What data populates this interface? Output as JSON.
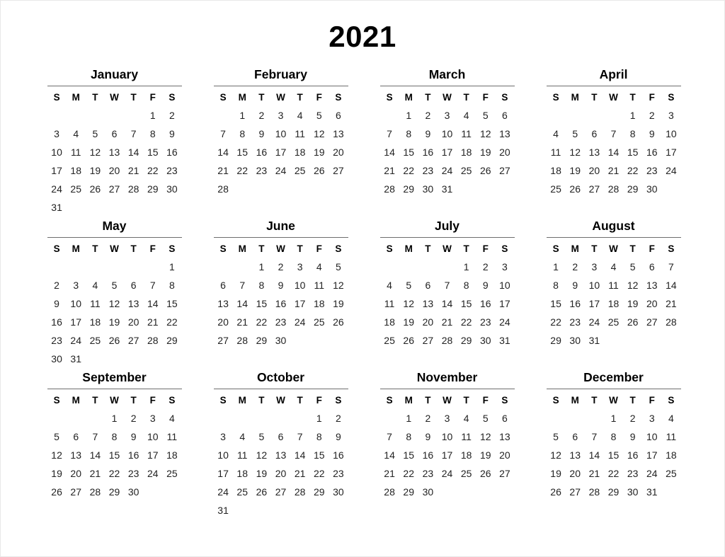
{
  "page": {
    "year_title": "2021",
    "background_color": "#ffffff",
    "text_color": "#1a1a1a",
    "rule_color": "#6e6e6e",
    "border_color": "#e8e8e8"
  },
  "weekday_headers": [
    "S",
    "M",
    "T",
    "W",
    "T",
    "F",
    "S"
  ],
  "chart_data": {
    "type": "table",
    "title": "2021",
    "first_day_of_week": "Sunday",
    "weekday_headers": [
      "S",
      "M",
      "T",
      "W",
      "T",
      "F",
      "S"
    ],
    "months": [
      {
        "name": "January",
        "index": 1,
        "days_in_month": 31,
        "start_weekday_index": 5,
        "weeks": [
          [
            "",
            "",
            "",
            "",
            "",
            "1",
            "2"
          ],
          [
            "3",
            "4",
            "5",
            "6",
            "7",
            "8",
            "9"
          ],
          [
            "10",
            "11",
            "12",
            "13",
            "14",
            "15",
            "16"
          ],
          [
            "17",
            "18",
            "19",
            "20",
            "21",
            "22",
            "23"
          ],
          [
            "24",
            "25",
            "26",
            "27",
            "28",
            "29",
            "30"
          ],
          [
            "31",
            "",
            "",
            "",
            "",
            "",
            ""
          ]
        ]
      },
      {
        "name": "February",
        "index": 2,
        "days_in_month": 28,
        "start_weekday_index": 1,
        "weeks": [
          [
            "",
            "1",
            "2",
            "3",
            "4",
            "5",
            "6"
          ],
          [
            "7",
            "8",
            "9",
            "10",
            "11",
            "12",
            "13"
          ],
          [
            "14",
            "15",
            "16",
            "17",
            "18",
            "19",
            "20"
          ],
          [
            "21",
            "22",
            "23",
            "24",
            "25",
            "26",
            "27"
          ],
          [
            "28",
            "",
            "",
            "",
            "",
            "",
            ""
          ]
        ]
      },
      {
        "name": "March",
        "index": 3,
        "days_in_month": 31,
        "start_weekday_index": 1,
        "weeks": [
          [
            "",
            "1",
            "2",
            "3",
            "4",
            "5",
            "6"
          ],
          [
            "7",
            "8",
            "9",
            "10",
            "11",
            "12",
            "13"
          ],
          [
            "14",
            "15",
            "16",
            "17",
            "18",
            "19",
            "20"
          ],
          [
            "21",
            "22",
            "23",
            "24",
            "25",
            "26",
            "27"
          ],
          [
            "28",
            "29",
            "30",
            "31",
            "",
            "",
            ""
          ]
        ]
      },
      {
        "name": "April",
        "index": 4,
        "days_in_month": 30,
        "start_weekday_index": 4,
        "weeks": [
          [
            "",
            "",
            "",
            "",
            "1",
            "2",
            "3"
          ],
          [
            "4",
            "5",
            "6",
            "7",
            "8",
            "9",
            "10"
          ],
          [
            "11",
            "12",
            "13",
            "14",
            "15",
            "16",
            "17"
          ],
          [
            "18",
            "19",
            "20",
            "21",
            "22",
            "23",
            "24"
          ],
          [
            "25",
            "26",
            "27",
            "28",
            "29",
            "30",
            ""
          ]
        ]
      },
      {
        "name": "May",
        "index": 5,
        "days_in_month": 31,
        "start_weekday_index": 6,
        "weeks": [
          [
            "",
            "",
            "",
            "",
            "",
            "",
            "1"
          ],
          [
            "2",
            "3",
            "4",
            "5",
            "6",
            "7",
            "8"
          ],
          [
            "9",
            "10",
            "11",
            "12",
            "13",
            "14",
            "15"
          ],
          [
            "16",
            "17",
            "18",
            "19",
            "20",
            "21",
            "22"
          ],
          [
            "23",
            "24",
            "25",
            "26",
            "27",
            "28",
            "29"
          ],
          [
            "30",
            "31",
            "",
            "",
            "",
            "",
            ""
          ]
        ]
      },
      {
        "name": "June",
        "index": 6,
        "days_in_month": 30,
        "start_weekday_index": 2,
        "weeks": [
          [
            "",
            "",
            "1",
            "2",
            "3",
            "4",
            "5"
          ],
          [
            "6",
            "7",
            "8",
            "9",
            "10",
            "11",
            "12"
          ],
          [
            "13",
            "14",
            "15",
            "16",
            "17",
            "18",
            "19"
          ],
          [
            "20",
            "21",
            "22",
            "23",
            "24",
            "25",
            "26"
          ],
          [
            "27",
            "28",
            "29",
            "30",
            "",
            "",
            ""
          ]
        ]
      },
      {
        "name": "July",
        "index": 7,
        "days_in_month": 31,
        "start_weekday_index": 4,
        "weeks": [
          [
            "",
            "",
            "",
            "",
            "1",
            "2",
            "3"
          ],
          [
            "4",
            "5",
            "6",
            "7",
            "8",
            "9",
            "10"
          ],
          [
            "11",
            "12",
            "13",
            "14",
            "15",
            "16",
            "17"
          ],
          [
            "18",
            "19",
            "20",
            "21",
            "22",
            "23",
            "24"
          ],
          [
            "25",
            "26",
            "27",
            "28",
            "29",
            "30",
            "31"
          ]
        ]
      },
      {
        "name": "August",
        "index": 8,
        "days_in_month": 31,
        "start_weekday_index": 0,
        "weeks": [
          [
            "1",
            "2",
            "3",
            "4",
            "5",
            "6",
            "7"
          ],
          [
            "8",
            "9",
            "10",
            "11",
            "12",
            "13",
            "14"
          ],
          [
            "15",
            "16",
            "17",
            "18",
            "19",
            "20",
            "21"
          ],
          [
            "22",
            "23",
            "24",
            "25",
            "26",
            "27",
            "28"
          ],
          [
            "29",
            "30",
            "31",
            "",
            "",
            "",
            ""
          ]
        ]
      },
      {
        "name": "September",
        "index": 9,
        "days_in_month": 30,
        "start_weekday_index": 3,
        "weeks": [
          [
            "",
            "",
            "",
            "1",
            "2",
            "3",
            "4"
          ],
          [
            "5",
            "6",
            "7",
            "8",
            "9",
            "10",
            "11"
          ],
          [
            "12",
            "13",
            "14",
            "15",
            "16",
            "17",
            "18"
          ],
          [
            "19",
            "20",
            "21",
            "22",
            "23",
            "24",
            "25"
          ],
          [
            "26",
            "27",
            "28",
            "29",
            "30",
            "",
            ""
          ]
        ]
      },
      {
        "name": "October",
        "index": 10,
        "days_in_month": 31,
        "start_weekday_index": 5,
        "weeks": [
          [
            "",
            "",
            "",
            "",
            "",
            "1",
            "2"
          ],
          [
            "3",
            "4",
            "5",
            "6",
            "7",
            "8",
            "9"
          ],
          [
            "10",
            "11",
            "12",
            "13",
            "14",
            "15",
            "16"
          ],
          [
            "17",
            "18",
            "19",
            "20",
            "21",
            "22",
            "23"
          ],
          [
            "24",
            "25",
            "26",
            "27",
            "28",
            "29",
            "30"
          ],
          [
            "31",
            "",
            "",
            "",
            "",
            "",
            ""
          ]
        ]
      },
      {
        "name": "November",
        "index": 11,
        "days_in_month": 30,
        "start_weekday_index": 1,
        "weeks": [
          [
            "",
            "1",
            "2",
            "3",
            "4",
            "5",
            "6"
          ],
          [
            "7",
            "8",
            "9",
            "10",
            "11",
            "12",
            "13"
          ],
          [
            "14",
            "15",
            "16",
            "17",
            "18",
            "19",
            "20"
          ],
          [
            "21",
            "22",
            "23",
            "24",
            "25",
            "26",
            "27"
          ],
          [
            "28",
            "29",
            "30",
            "",
            "",
            "",
            ""
          ]
        ]
      },
      {
        "name": "December",
        "index": 12,
        "days_in_month": 31,
        "start_weekday_index": 3,
        "weeks": [
          [
            "",
            "",
            "",
            "1",
            "2",
            "3",
            "4"
          ],
          [
            "5",
            "6",
            "7",
            "8",
            "9",
            "10",
            "11"
          ],
          [
            "12",
            "13",
            "14",
            "15",
            "16",
            "17",
            "18"
          ],
          [
            "19",
            "20",
            "21",
            "22",
            "23",
            "24",
            "25"
          ],
          [
            "26",
            "27",
            "28",
            "29",
            "30",
            "31",
            ""
          ]
        ]
      }
    ]
  }
}
